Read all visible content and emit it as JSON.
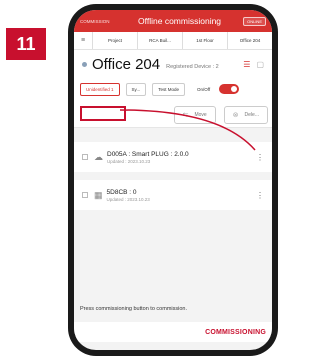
{
  "step_number": "11",
  "topbar": {
    "left": "COMMISSION",
    "title": "Offline commissioning",
    "right": "ONLINE"
  },
  "breadcrumb": {
    "menu_icon": "menu-icon",
    "items": [
      "Project",
      "RCA Buil...",
      "1st Floor",
      "Office 204"
    ]
  },
  "header": {
    "name": "Office 204",
    "registered": "Registered Device : 2"
  },
  "tabs": [
    {
      "label": "Unidentified 1",
      "active": true
    },
    {
      "label": "Sy...",
      "active": false
    },
    {
      "label": "Test Mode",
      "active": false
    }
  ],
  "onoff_label": "On/Off",
  "actions": [
    {
      "label": "Move",
      "icon": "move-icon"
    },
    {
      "label": "Dele...",
      "icon": "delete-icon"
    }
  ],
  "devices": [
    {
      "title": "D005A : Smart PLUG : 2.0.0",
      "updated": "Updated : 2023.10.23",
      "icon": "cloud-device-icon"
    },
    {
      "title": "5D8CB : 0",
      "updated": "Updated : 2023.10.23",
      "icon": "sensor-device-icon"
    }
  ],
  "hint": "Press commissioning button to commission.",
  "commission_button": "COMMISSIONING",
  "colors": {
    "brand_red": "#d6322f",
    "highlight_red": "#c8102e"
  }
}
